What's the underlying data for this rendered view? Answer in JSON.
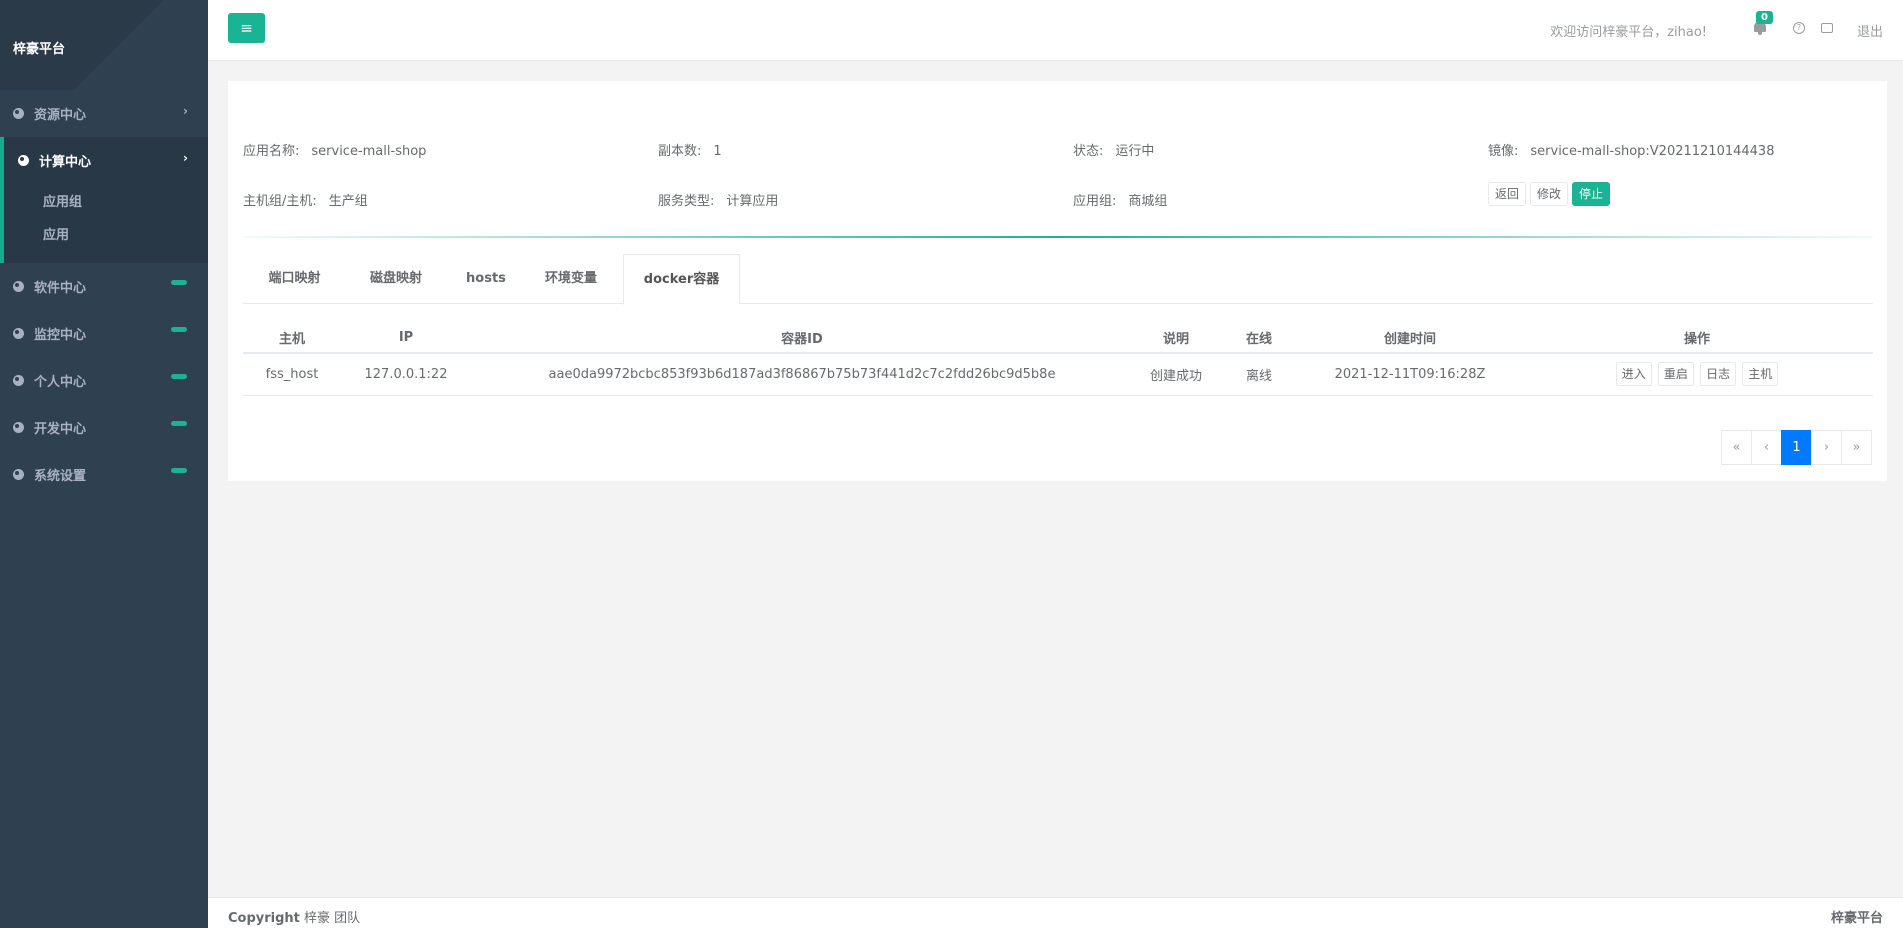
{
  "brand": "梓豪平台",
  "sidebar": {
    "items": [
      {
        "label": "资源中心"
      },
      {
        "label": "计算中心",
        "subs": [
          "应用组",
          "应用"
        ]
      },
      {
        "label": "软件中心"
      },
      {
        "label": "监控中心"
      },
      {
        "label": "个人中心"
      },
      {
        "label": "开发中心"
      },
      {
        "label": "系统设置"
      }
    ]
  },
  "header": {
    "menu_icon": "≡",
    "welcome": "欢迎访问梓豪平台，zihao!",
    "notify_count": "0",
    "help_icon": "?",
    "logout": "退出"
  },
  "app_info": {
    "name_label": "应用名称:",
    "name": "service-mall-shop",
    "replicas_label": "副本数:",
    "replicas": "1",
    "status_label": "状态:",
    "status": "运行中",
    "image_label": "镜像:",
    "image": "service-mall-shop:V20211210144438",
    "host_label": "主机组/主机:",
    "host": "生产组",
    "service_type_label": "服务类型:",
    "service_type": "计算应用",
    "app_group_label": "应用组:",
    "app_group": "商城组",
    "btn_back": "返回",
    "btn_edit": "修改",
    "btn_stop": "停止"
  },
  "tabs": [
    "端口映射",
    "磁盘映射",
    "hosts",
    "环境变量",
    "docker容器"
  ],
  "table": {
    "headers": [
      "主机",
      "IP",
      "容器ID",
      "说明",
      "在线",
      "创建时间",
      "操作"
    ],
    "rows": [
      {
        "host": "fss_host",
        "ip": "127.0.0.1:22",
        "container_id": "aae0da9972bcbc853f93b6d187ad3f86867b75b73f441d2c7c2fdd26bc9d5b8e",
        "desc": "创建成功",
        "online": "离线",
        "created": "2021-12-11T09:16:28Z",
        "ops": [
          "进入",
          "重启",
          "日志",
          "主机"
        ]
      }
    ]
  },
  "pager": {
    "first": "«",
    "prev": "‹",
    "current": "1",
    "next": "›",
    "last": "»"
  },
  "footer": {
    "copyright": "Copyright",
    "team": "梓豪 团队",
    "right": "梓豪平台"
  }
}
